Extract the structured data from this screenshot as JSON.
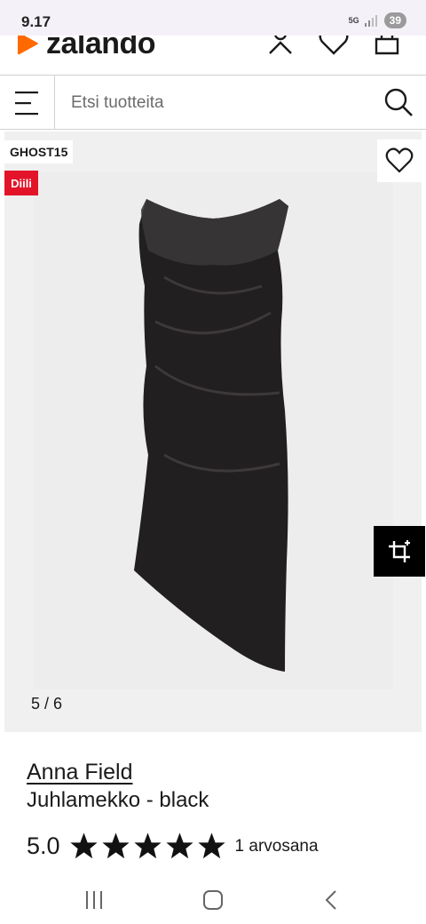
{
  "status_bar": {
    "time": "9.17",
    "network": "5G",
    "battery": "39"
  },
  "header": {
    "logo": "zalando",
    "brand_color": "#ff6900"
  },
  "search": {
    "placeholder": "Etsi tuotteita"
  },
  "gallery": {
    "promo_code": "GHOST15",
    "deal_badge": "Diili",
    "deal_color": "#e3142a",
    "counter": "5 / 6"
  },
  "product": {
    "brand": "Anna Field",
    "name": "Juhlamekko - black",
    "rating": "5.0",
    "stars": 5,
    "reviews": "1 arvosana"
  },
  "icons": {
    "account": "account-icon",
    "wishlist": "heart-icon",
    "bag": "bag-icon",
    "menu": "menu-icon",
    "search": "search-icon",
    "crop": "crop-icon"
  }
}
